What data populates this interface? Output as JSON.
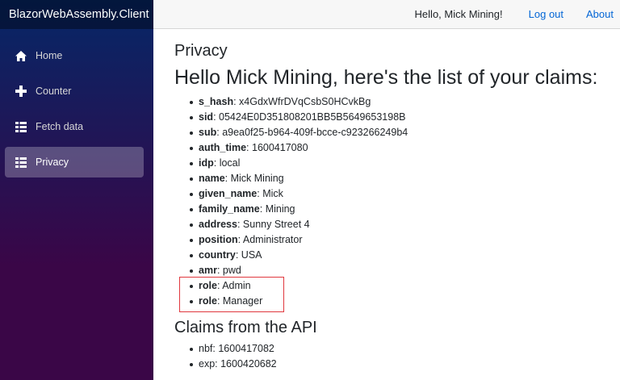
{
  "brand": "BlazorWebAssembly.Client",
  "nav": [
    {
      "label": "Home",
      "icon": "home-icon",
      "active": false
    },
    {
      "label": "Counter",
      "icon": "plus-icon",
      "active": false
    },
    {
      "label": "Fetch data",
      "icon": "list-icon",
      "active": false
    },
    {
      "label": "Privacy",
      "icon": "list-icon",
      "active": true
    }
  ],
  "topbar": {
    "greeting": "Hello, Mick Mining!",
    "logout": "Log out",
    "about": "About"
  },
  "page": {
    "title": "Privacy",
    "claims_heading": "Hello Mick Mining, here's the list of your claims:",
    "claims": [
      {
        "key": "s_hash",
        "value": "x4GdxWfrDVqCsbS0HCvkBg"
      },
      {
        "key": "sid",
        "value": "05424E0D351808201BB5B5649653198B"
      },
      {
        "key": "sub",
        "value": "a9ea0f25-b964-409f-bcce-c923266249b4"
      },
      {
        "key": "auth_time",
        "value": "1600417080"
      },
      {
        "key": "idp",
        "value": "local"
      },
      {
        "key": "name",
        "value": "Mick Mining"
      },
      {
        "key": "given_name",
        "value": "Mick"
      },
      {
        "key": "family_name",
        "value": "Mining"
      },
      {
        "key": "address",
        "value": "Sunny Street 4"
      },
      {
        "key": "position",
        "value": "Administrator"
      },
      {
        "key": "country",
        "value": "USA"
      },
      {
        "key": "amr",
        "value": "pwd"
      },
      {
        "key": "role",
        "value": "Admin"
      },
      {
        "key": "role",
        "value": "Manager"
      }
    ],
    "api_heading": "Claims from the API",
    "api_claims": [
      {
        "key": "nbf",
        "value": "1600417082"
      },
      {
        "key": "exp",
        "value": "1600420682"
      }
    ]
  },
  "colors": {
    "highlight": "#e0383e",
    "link": "#0366d6"
  }
}
